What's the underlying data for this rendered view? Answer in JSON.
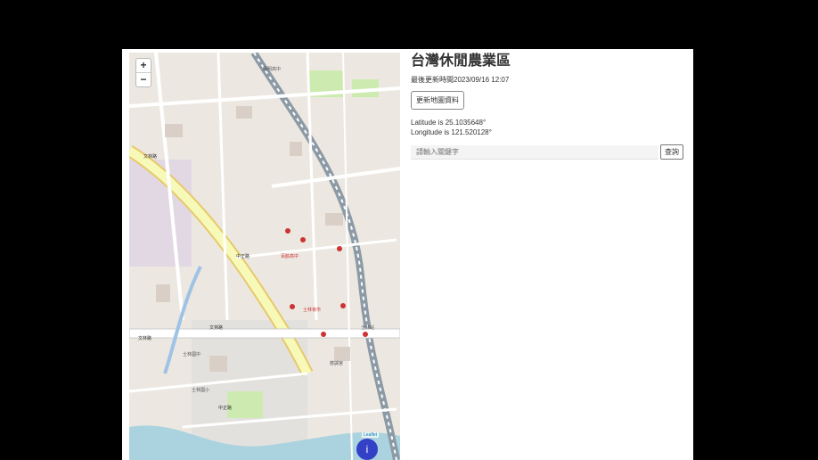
{
  "map": {
    "zoom_in": "+",
    "zoom_out": "−",
    "attribution": "Leaflet",
    "info_label": "i",
    "labels": {
      "wenlin_road_1": "文林路",
      "wenlin_road_2": "文林路",
      "road_left_top": "文林路",
      "road_mid": "中正路",
      "zhongzheng_road": "中正路",
      "poi_1": "士林國中",
      "poi_2": "百齡高中",
      "poi_3": "陽明高中",
      "poi_4": "士林夜市",
      "poi_5": "慈誠宮",
      "poi_6": "士林站",
      "poi_7": "士林國小"
    },
    "colors": {
      "land": "#ece8e1",
      "primary_road": "#f7f9b8",
      "rail": "#8c9aa6",
      "river": "#aad3df",
      "park": "#cdebb0",
      "residential": "#e2d8e4"
    }
  },
  "panel": {
    "title": "台灣休閒農業區",
    "updated": "最後更新時間2023/09/16 12:07",
    "refresh_button": "更新地圖資料",
    "latitude": "Latitude is 25.1035648°",
    "longitude": "Longitude is 121.520128°",
    "search_placeholder": "請輸入關鍵字",
    "search_button": "查詢"
  }
}
